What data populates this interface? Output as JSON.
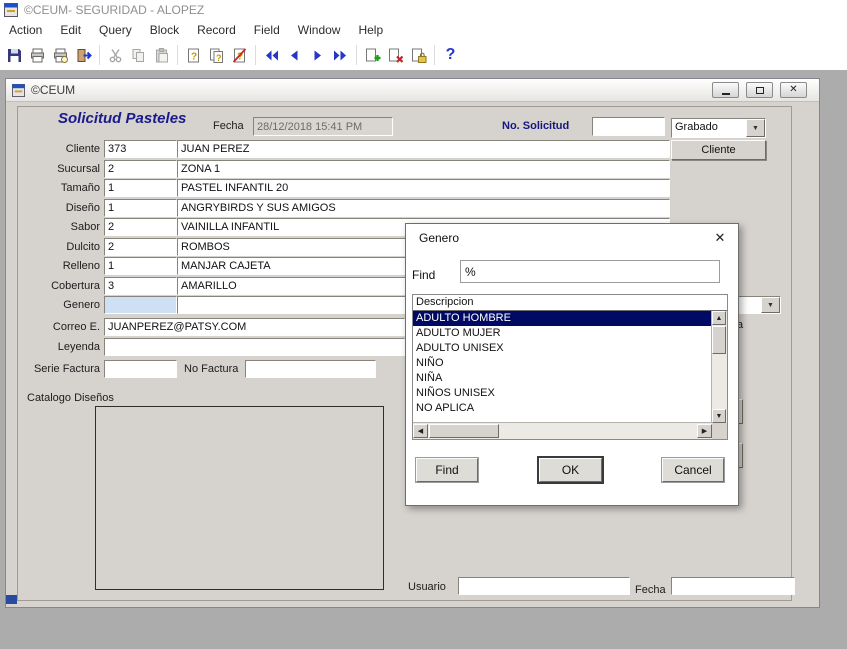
{
  "app": {
    "title": "©CEUM- SEGURIDAD - ALOPEZ"
  },
  "menu": {
    "items": [
      "Action",
      "Edit",
      "Query",
      "Block",
      "Record",
      "Field",
      "Window",
      "Help"
    ]
  },
  "toolbar": {
    "icons": [
      "save",
      "print",
      "print-preview",
      "exit",
      "cut",
      "copy",
      "paste",
      "enter-query",
      "execute-query",
      "cancel-query",
      "previous-block",
      "previous-record",
      "next-record",
      "next-block",
      "insert-record",
      "delete-record",
      "lock-record",
      "help"
    ]
  },
  "inner_window": {
    "title": "©CEUM"
  },
  "colors": {
    "form_bg": "#d6d3ce",
    "navy_label": "#16167e",
    "selection": "#000a64",
    "focus_field": "#cfe0f5"
  },
  "form": {
    "title": "Solicitud Pasteles",
    "fecha": {
      "label": "Fecha",
      "value": "28/12/2018 15:41 PM"
    },
    "no_solicitud": {
      "label": "No. Solicitud",
      "value": ""
    },
    "status_combo": {
      "value": "Grabado"
    },
    "cliente_button": "Cliente",
    "rows": [
      {
        "label": "Cliente",
        "code": "373",
        "desc": "JUAN PEREZ"
      },
      {
        "label": "Sucursal",
        "code": "2",
        "desc": "ZONA 1"
      },
      {
        "label": "Tamaño",
        "code": "1",
        "desc": "PASTEL INFANTIL 20"
      },
      {
        "label": "Diseño",
        "code": "1",
        "desc": "ANGRYBIRDS Y SUS AMIGOS"
      },
      {
        "label": "Sabor",
        "code": "2",
        "desc": "VAINILLA INFANTIL"
      },
      {
        "label": "Dulcito",
        "code": "2",
        "desc": "ROMBOS"
      },
      {
        "label": "Relleno",
        "code": "1",
        "desc": "MANJAR CAJETA"
      },
      {
        "label": "Cobertura",
        "code": "3",
        "desc": "AMARILLO"
      },
      {
        "label": "Genero",
        "code": "",
        "desc": ""
      }
    ],
    "correo": {
      "label": "Correo E.",
      "value": "JUANPEREZ@PATSY.COM"
    },
    "leyenda": {
      "label": "Leyenda",
      "value": ""
    },
    "serie_factura": {
      "label": "Serie Factura",
      "value": ""
    },
    "no_factura": {
      "label": "No Factura",
      "value": ""
    },
    "catalogo": {
      "label": "Catalogo Diseños"
    },
    "usuario": {
      "label": "Usuario",
      "value": ""
    },
    "fecha_bottom": {
      "label": "Fecha",
      "value": ""
    },
    "fragments": {
      "hidden_label": "a"
    }
  },
  "dialog": {
    "title": "Genero",
    "find_label": "Find",
    "find_value": "%",
    "list_header": "Descripcion",
    "items": [
      "ADULTO HOMBRE",
      "ADULTO MUJER",
      "ADULTO UNISEX",
      "NIÑO",
      "NIÑA",
      "NIÑOS UNISEX",
      "NO APLICA"
    ],
    "selected_index": 0,
    "buttons": {
      "find": "Find",
      "ok": "OK",
      "cancel": "Cancel"
    }
  }
}
